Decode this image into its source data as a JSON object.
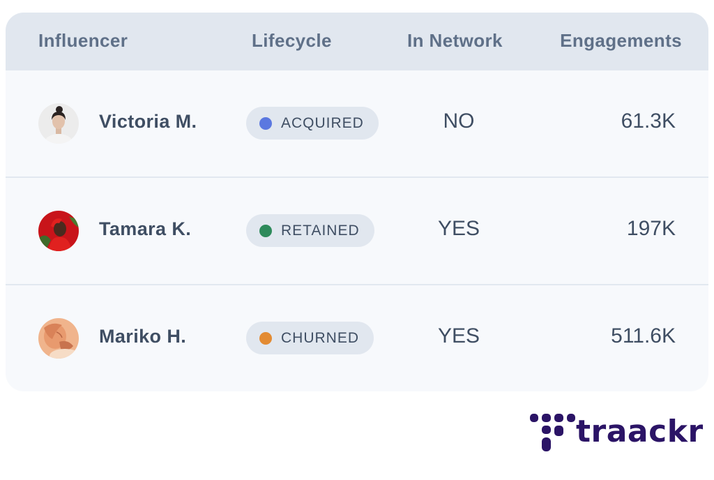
{
  "table": {
    "headers": {
      "influencer": "Influencer",
      "lifecycle": "Lifecycle",
      "in_network": "In Network",
      "engagements": "Engagements"
    },
    "rows": [
      {
        "name": "Victoria M.",
        "avatar_icon": "avatar-photo-woman",
        "lifecycle": "ACQUIRED",
        "lifecycle_color": "#5b78e0",
        "in_network": "NO",
        "engagements": "61.3K"
      },
      {
        "name": "Tamara K.",
        "avatar_icon": "avatar-photo-woman",
        "lifecycle": "RETAINED",
        "lifecycle_color": "#2e8a5b",
        "in_network": "YES",
        "engagements": "197K"
      },
      {
        "name": "Mariko H.",
        "avatar_icon": "avatar-photo-woman",
        "lifecycle": "CHURNED",
        "lifecycle_color": "#e38b33",
        "in_network": "YES",
        "engagements": "511.6K"
      }
    ]
  },
  "brand": {
    "name": "traackr",
    "logo_icon": "traackr-dots-logo",
    "color": "#2b1466"
  },
  "colors": {
    "header_bg": "#e1e7ef",
    "card_bg": "#f7f9fc",
    "text": "#3f4e63",
    "header_text": "#5f7088"
  }
}
